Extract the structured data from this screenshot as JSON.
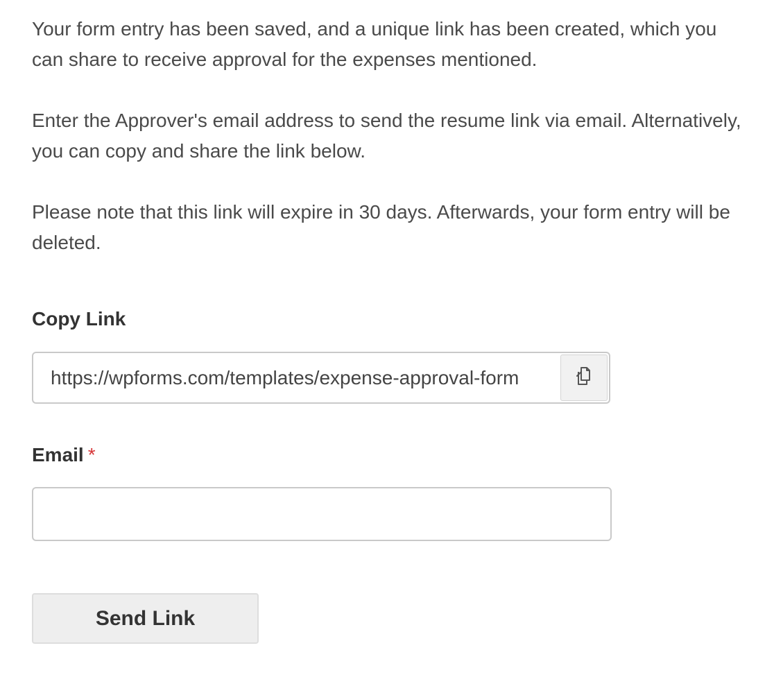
{
  "message": {
    "paragraphs": [
      "Your form entry has been saved, and a unique link has been created, which you can share to receive approval for the expenses mentioned.",
      "Enter the Approver's email address to send the resume link via email. Alternatively, you can copy and share the link below.",
      "Please note that this link will expire in 30 days. Afterwards, your form entry will be deleted."
    ]
  },
  "copy_link": {
    "label": "Copy Link",
    "url": "https://wpforms.com/templates/expense-approval-form",
    "icon": "copy-icon"
  },
  "email": {
    "label": "Email",
    "required_marker": "*",
    "value": "",
    "placeholder": ""
  },
  "send_button": {
    "label": "Send Link"
  },
  "colors": {
    "required": "#d63638",
    "text": "#4a4a4a",
    "border": "#c9c9c9",
    "button_bg": "#eeeeee"
  }
}
